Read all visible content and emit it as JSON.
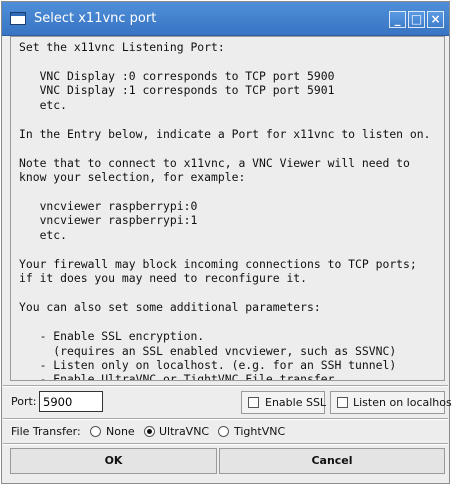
{
  "window": {
    "title": "Select x11vnc port"
  },
  "titlebar": {
    "minimize": "_",
    "maximize": "□",
    "close": "×"
  },
  "info_text": "Set the x11vnc Listening Port:\n\n   VNC Display :0 corresponds to TCP port 5900\n   VNC Display :1 corresponds to TCP port 5901\n   etc.\n\nIn the Entry below, indicate a Port for x11vnc to listen on.\n\nNote that to connect to x11vnc, a VNC Viewer will need to\nknow your selection, for example:\n\n   vncviewer raspberrypi:0\n   vncviewer raspberrypi:1\n   etc.\n\nYour firewall may block incoming connections to TCP ports;\nif it does you may need to reconfigure it.\n\nYou can also set some additional parameters:\n\n   - Enable SSL encryption.\n     (requires an SSL enabled vncviewer, such as SSVNC)\n   - Listen only on localhost. (e.g. for an SSH tunnel)\n   - Enable UltraVNC or TightVNC File transfer.",
  "port": {
    "label": "Port:",
    "value": "5900"
  },
  "ssl": {
    "label": "Enable SSL",
    "checked": false
  },
  "localhost": {
    "label": "Listen on localhost",
    "checked": false
  },
  "file_transfer": {
    "label": "File Transfer:",
    "options": [
      "None",
      "UltraVNC",
      "TightVNC"
    ],
    "selected": "UltraVNC"
  },
  "buttons": {
    "ok": "OK",
    "cancel": "Cancel"
  }
}
